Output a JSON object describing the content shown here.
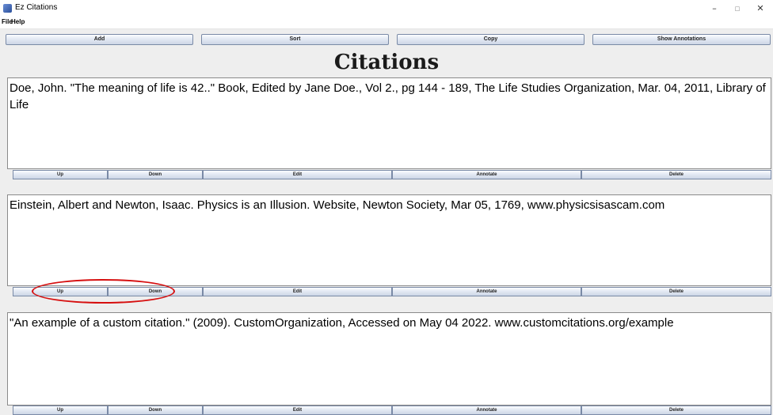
{
  "window": {
    "title": "Ez Citations",
    "minimize": "–",
    "maximize": "▫",
    "close": "✕"
  },
  "menu": {
    "file": "File",
    "help": "Help"
  },
  "toolbar": {
    "add": "Add",
    "sort": "Sort",
    "copy": "Copy",
    "show_annotations": "Show Annotations"
  },
  "heading": "Citations",
  "row_buttons": {
    "up": "Up",
    "down": "Down",
    "edit": "Edit",
    "annotate": "Annotate",
    "delete": "Delete"
  },
  "citations": [
    {
      "text": "Doe, John. \"The meaning of life is 42..\" Book, Edited by Jane Doe., Vol 2., pg 144 - 189, The Life Studies Organization, Mar. 04, 2011, Library of Life"
    },
    {
      "text": "Einstein, Albert and Newton, Isaac. Physics is an Illusion. Website, Newton Society, Mar 05, 1769, www.physicsisascam.com"
    },
    {
      "text": "\"An example of a custom citation.\" (2009). CustomOrganization, Accessed on May 04 2022. www.customcitations.org/example"
    }
  ],
  "colors": {
    "highlight": "#d60f0f",
    "button_border": "#7a8aa6"
  }
}
